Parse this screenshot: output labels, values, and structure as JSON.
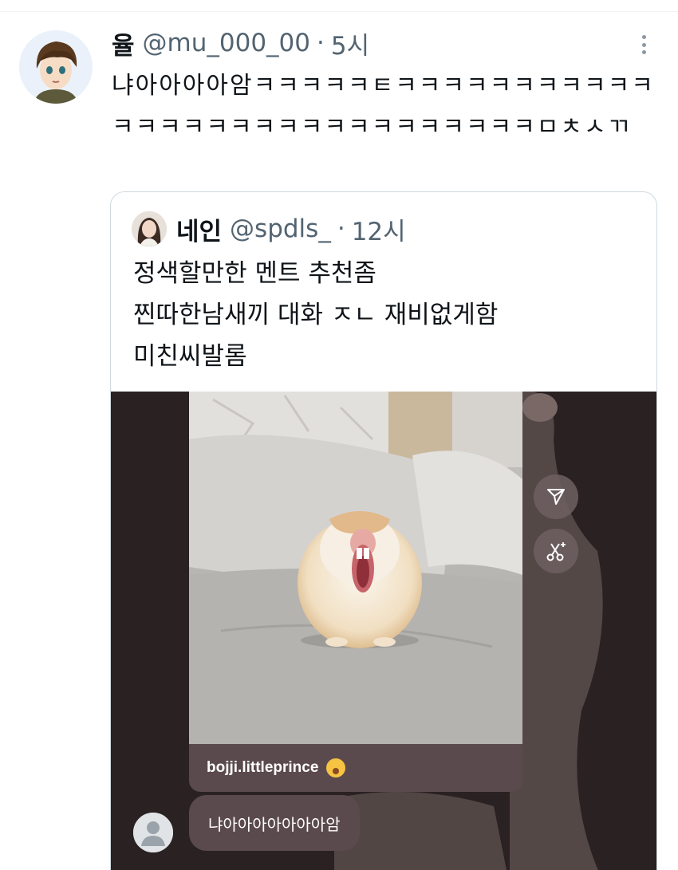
{
  "tweet": {
    "author_name": "율",
    "author_handle": "@mu_000_00",
    "separator": "·",
    "time": "5시",
    "text": "냐아아아아암ㅋㅋㅋㅋㅋㅌㅋㅋㅋㅋㅋㅋㅋㅋㅋㅋㅋㅋㅋㅋㅋㅋㅋㅋㅋㅋㅋㅋㅋㅋㅋㅋㅋㅋㅋㅁㅊㅅㄲ"
  },
  "quote": {
    "author_name": "네인",
    "author_handle": "@spdls_",
    "separator": "·",
    "time": "12시",
    "lines": [
      "정색할만한 멘트 추천좀",
      "찐따한남새끼 대화 ㅈㄴ 재비없게함",
      "미친씨발롬"
    ]
  },
  "media": {
    "caption_account": "bojji.littleprince",
    "reply_text": "냐아아아아아아아암"
  },
  "colors": {
    "text_primary": "#0f1419",
    "text_secondary": "#536471",
    "border": "#cfd9de",
    "media_bg": "#2a2123",
    "bubble": "#5b4a4d"
  },
  "icons": [
    "more-vertical-icon",
    "send-icon",
    "scissors-sparkle-icon",
    "default-user-icon"
  ]
}
